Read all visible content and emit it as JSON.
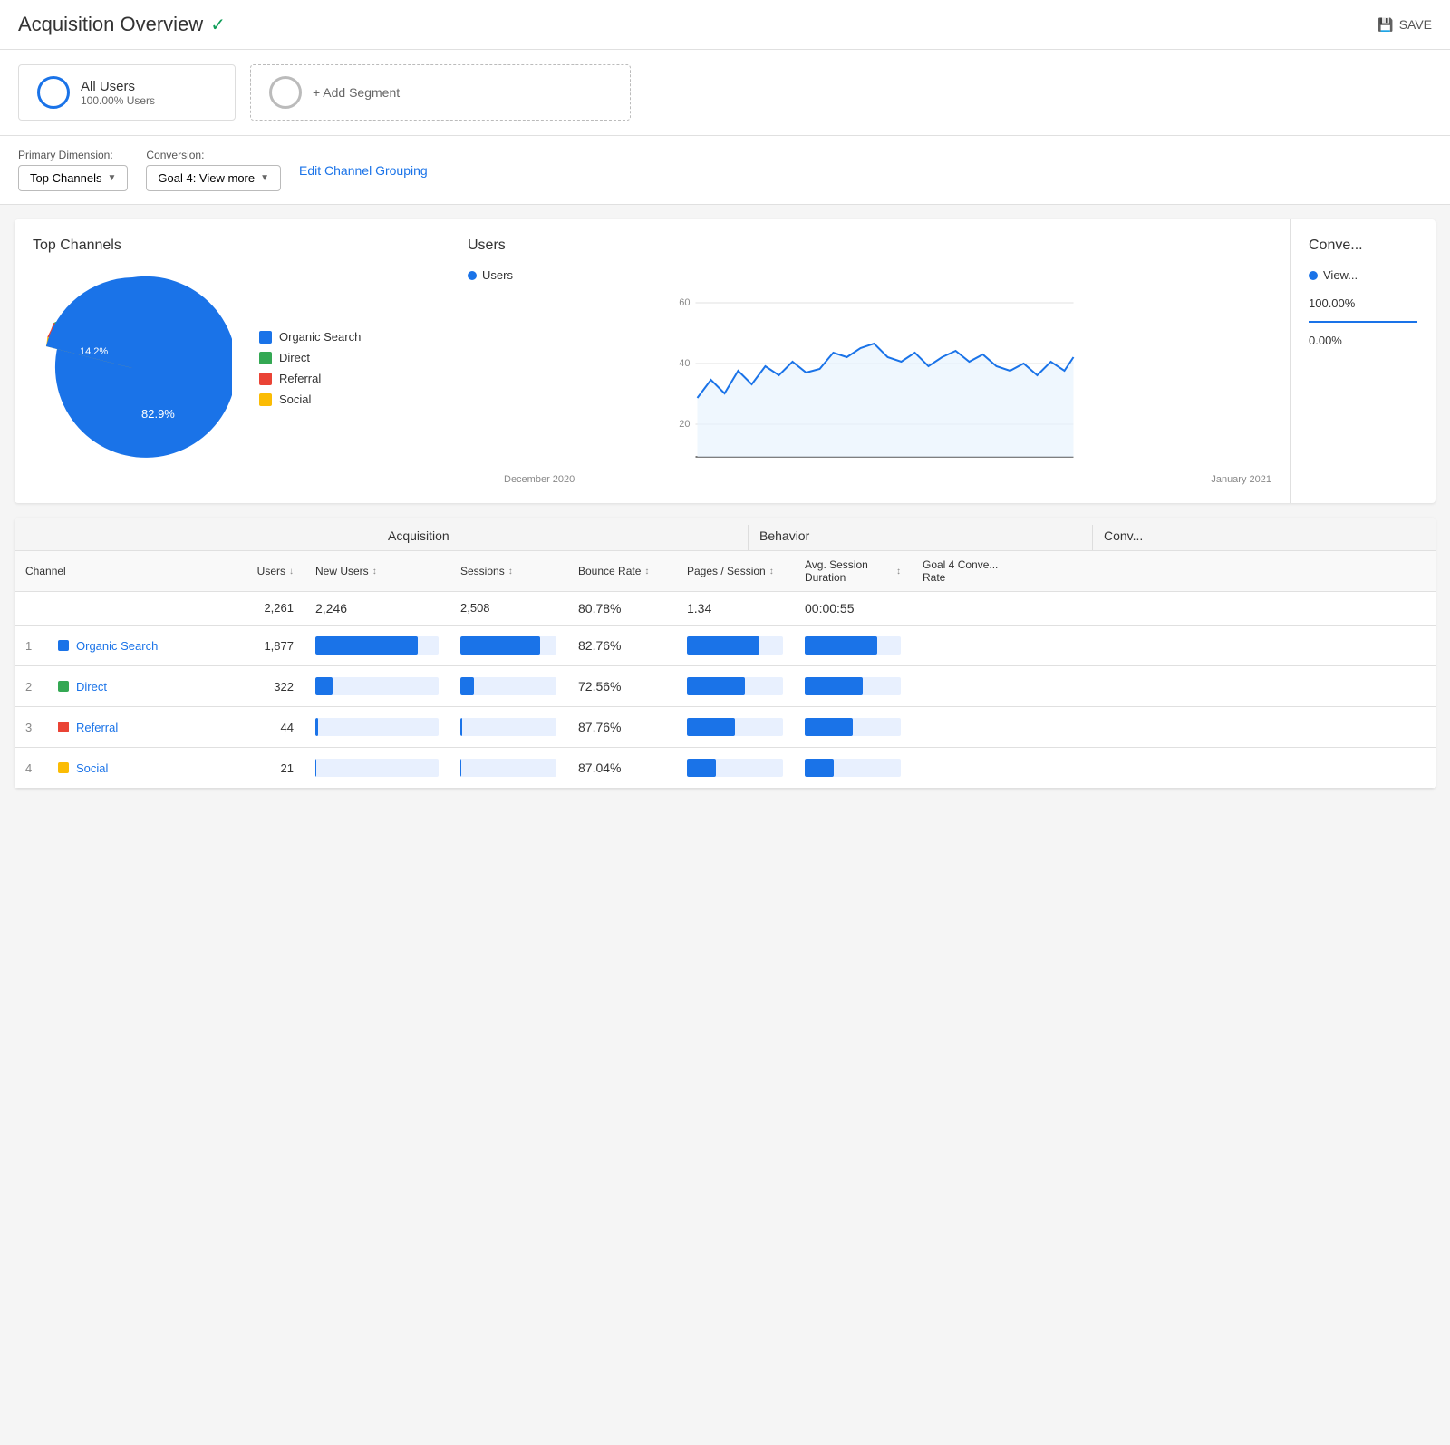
{
  "header": {
    "title": "Acquisition Overview",
    "verified": "✓",
    "save_label": "SAVE"
  },
  "segments": {
    "all_users": {
      "name": "All Users",
      "sub": "100.00% Users"
    },
    "add_segment_label": "+ Add Segment"
  },
  "controls": {
    "primary_dimension_label": "Primary Dimension:",
    "conversion_label": "Conversion:",
    "top_channels_label": "Top Channels",
    "goal4_label": "Goal 4: View more",
    "edit_link": "Edit Channel Grouping"
  },
  "pie_chart": {
    "title": "Top Channels",
    "segments": [
      {
        "label": "Organic Search",
        "color": "#1a73e8",
        "pct": 82.9,
        "start": 0,
        "end": 298
      },
      {
        "label": "Direct",
        "color": "#34a853",
        "pct": 14.2,
        "start": 298,
        "end": 349
      },
      {
        "label": "Referral",
        "color": "#ea4335",
        "pct": 2.1,
        "start": 349,
        "end": 357
      },
      {
        "label": "Social",
        "color": "#fbbc04",
        "pct": 0.8,
        "start": 357,
        "end": 360
      }
    ],
    "label_82": "82.9%",
    "label_14": "14.2%"
  },
  "line_chart": {
    "title": "Users",
    "legend_label": "Users",
    "x_labels": [
      "December 2020",
      "January 2021"
    ],
    "y_labels": [
      "60",
      "40",
      "20"
    ],
    "dot_color": "#1a73e8"
  },
  "conversion_chart": {
    "title": "Conve...",
    "legend_label": "View...",
    "value1": "100.00%",
    "value2": "0.00%"
  },
  "table": {
    "group_acquisition": "Acquisition",
    "group_behavior": "Behavior",
    "group_conversion": "Conv...",
    "col_channel": "Channel",
    "col_users": "Users",
    "col_new_users": "New Users",
    "col_sessions": "Sessions",
    "col_bounce": "Bounce Rate",
    "col_pages": "Pages / Session",
    "col_avg_session": "Avg. Session Duration",
    "col_goal": "Goal 4 Conve... Rate",
    "total": {
      "users": "2,261",
      "new_users": "2,246",
      "sessions": "2,508",
      "bounce_rate": "80.78%",
      "pages_session": "1.34",
      "avg_session": "00:00:55"
    },
    "rows": [
      {
        "num": "1",
        "channel": "Organic Search",
        "color": "#1a73e8",
        "users": "1,877",
        "users_bar_pct": 83,
        "new_users_bar_pct": 83,
        "sessions_bar_pct": 83,
        "bounce_rate": "82.76%",
        "bounce_bar_pct": 75,
        "pages_session": "",
        "pages_bar_pct": 75,
        "avg_session": "",
        "avg_bar_pct": 75,
        "goal": ""
      },
      {
        "num": "2",
        "channel": "Direct",
        "color": "#34a853",
        "users": "322",
        "users_bar_pct": 14,
        "new_users_bar_pct": 14,
        "sessions_bar_pct": 14,
        "bounce_rate": "72.56%",
        "bounce_bar_pct": 55,
        "pages_session": "",
        "pages_bar_pct": 60,
        "avg_session": "",
        "avg_bar_pct": 60,
        "goal": ""
      },
      {
        "num": "3",
        "channel": "Referral",
        "color": "#ea4335",
        "users": "44",
        "users_bar_pct": 2,
        "new_users_bar_pct": 2,
        "sessions_bar_pct": 2,
        "bounce_rate": "87.76%",
        "bounce_bar_pct": 80,
        "pages_session": "",
        "pages_bar_pct": 50,
        "avg_session": "",
        "avg_bar_pct": 50,
        "goal": ""
      },
      {
        "num": "4",
        "channel": "Social",
        "color": "#fbbc04",
        "users": "21",
        "users_bar_pct": 1,
        "new_users_bar_pct": 1,
        "sessions_bar_pct": 1,
        "bounce_rate": "87.04%",
        "bounce_bar_pct": 30,
        "pages_session": "",
        "pages_bar_pct": 30,
        "avg_session": "",
        "avg_bar_pct": 30,
        "goal": ""
      }
    ]
  }
}
